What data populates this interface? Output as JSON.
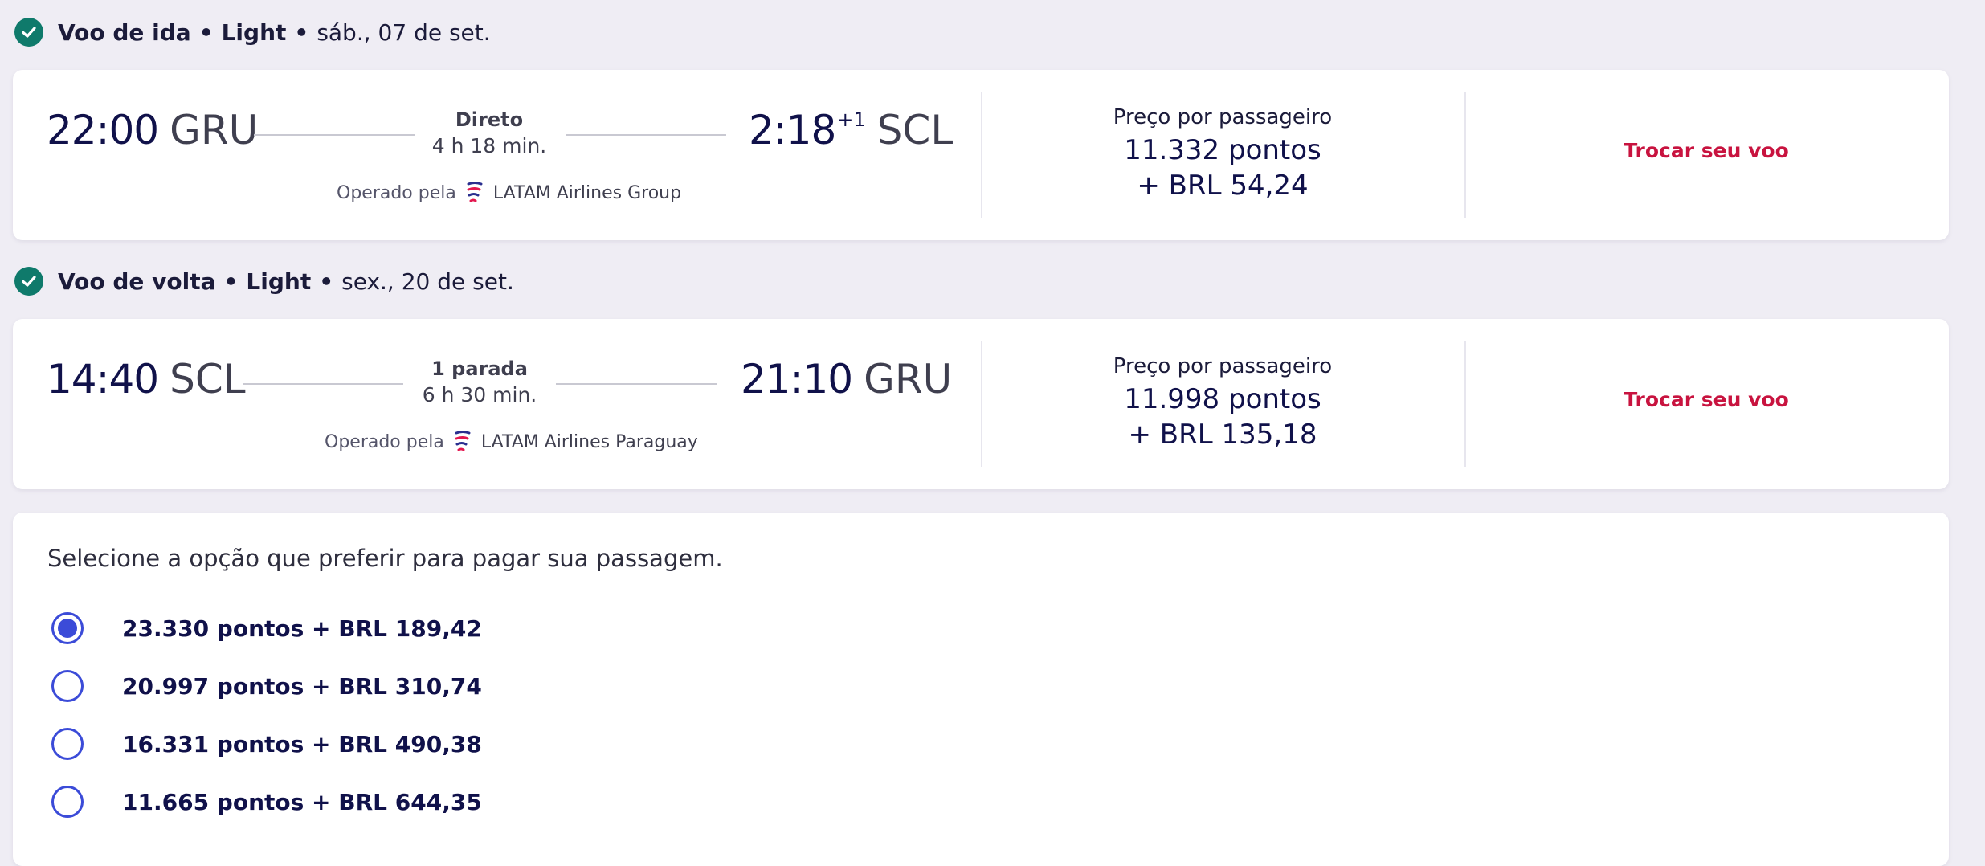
{
  "outbound": {
    "header": {
      "title": "Voo de ida",
      "fare": "Light",
      "date": "sáb., 07 de set."
    },
    "departure_time": "22:00",
    "departure_airport": "GRU",
    "arrival_time": "2:18",
    "arrival_day_offset": "+1",
    "arrival_airport": "SCL",
    "stops": "Direto",
    "duration": "4 h 18 min.",
    "operated_label": "Operado pela",
    "airline": "LATAM Airlines Group",
    "price_label": "Preço por passageiro",
    "price_points": "11.332 pontos",
    "price_money": "+ BRL 54,24",
    "change_label": "Trocar seu voo"
  },
  "return": {
    "header": {
      "title": "Voo de volta",
      "fare": "Light",
      "date": "sex., 20 de set."
    },
    "departure_time": "14:40",
    "departure_airport": "SCL",
    "arrival_time": "21:10",
    "arrival_airport": "GRU",
    "stops": "1 parada",
    "duration": "6 h 30 min.",
    "operated_label": "Operado pela",
    "airline": "LATAM Airlines Paraguay",
    "price_label": "Preço por passageiro",
    "price_points": "11.998 pontos",
    "price_money": "+ BRL 135,18",
    "change_label": "Trocar seu voo"
  },
  "payment": {
    "title": "Selecione a opção que preferir para pagar sua passagem.",
    "selected_index": 0,
    "options": [
      {
        "label": "23.330 pontos + BRL 189,42"
      },
      {
        "label": "20.997 pontos + BRL 310,74"
      },
      {
        "label": "16.331 pontos + BRL 490,38"
      },
      {
        "label": "11.665 pontos + BRL 644,35"
      }
    ]
  },
  "colors": {
    "background": "#efedf4",
    "check": "#0f7a6b",
    "link": "#c8133f",
    "radio": "#3b4bd8",
    "text_primary": "#10114a"
  },
  "icons": {
    "check": "check-circle-icon",
    "airline": "latam-logo-icon",
    "radio_selected": "radio-selected-icon",
    "radio_unselected": "radio-unselected-icon"
  }
}
